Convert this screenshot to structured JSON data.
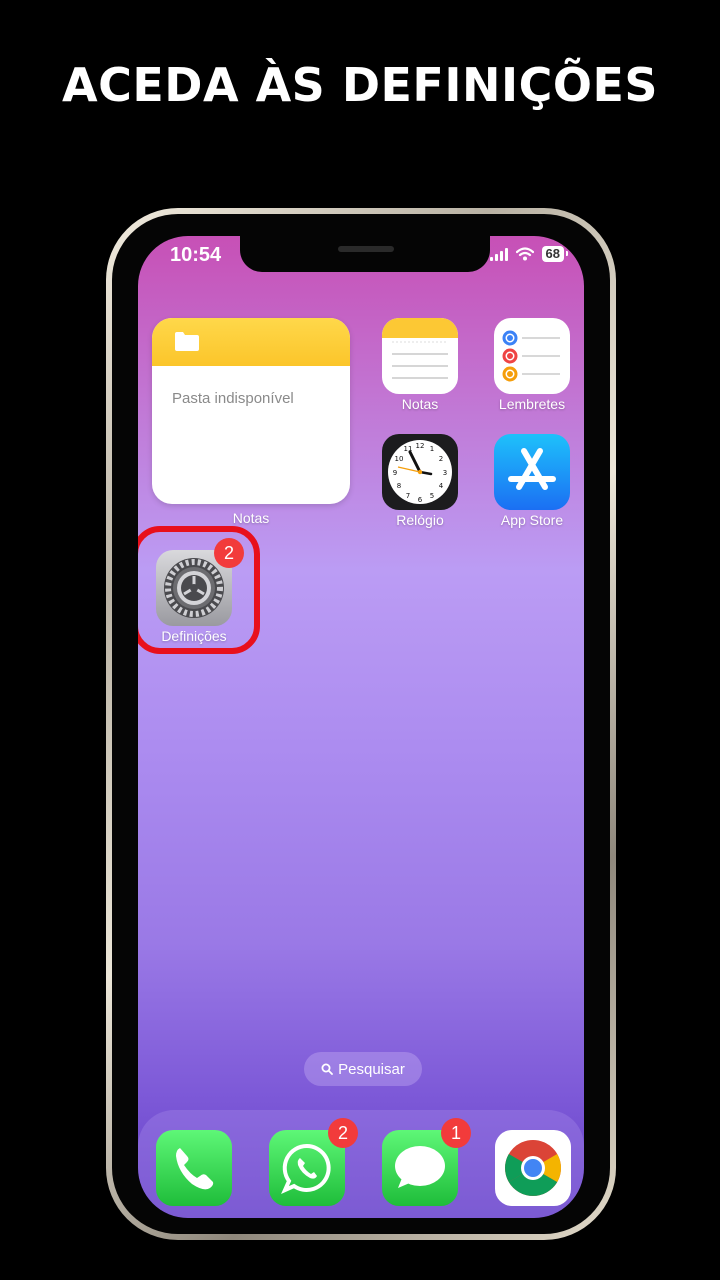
{
  "headline": "ACEDA ÀS DEFINIÇÕES",
  "status_bar": {
    "time": "10:54",
    "battery": "68"
  },
  "widget": {
    "text": "Pasta indisponível",
    "label": "Notas"
  },
  "apps": {
    "notes": {
      "label": "Notas",
      "icon": "notes-icon"
    },
    "reminders": {
      "label": "Lembretes",
      "icon": "reminders-icon"
    },
    "clock": {
      "label": "Relógio",
      "icon": "clock-icon"
    },
    "app_store": {
      "label": "App Store",
      "icon": "app-store-icon"
    },
    "settings": {
      "label": "Definições",
      "icon": "gear-icon",
      "badge": "2"
    }
  },
  "search": {
    "label": "Pesquisar"
  },
  "dock": {
    "phone": {
      "icon": "phone-icon"
    },
    "whatsapp": {
      "icon": "whatsapp-icon",
      "badge": "2"
    },
    "messages": {
      "icon": "messages-icon",
      "badge": "1"
    },
    "chrome": {
      "icon": "chrome-icon"
    }
  },
  "colors": {
    "highlight": "#e8101c",
    "badge": "#f23b3b"
  }
}
